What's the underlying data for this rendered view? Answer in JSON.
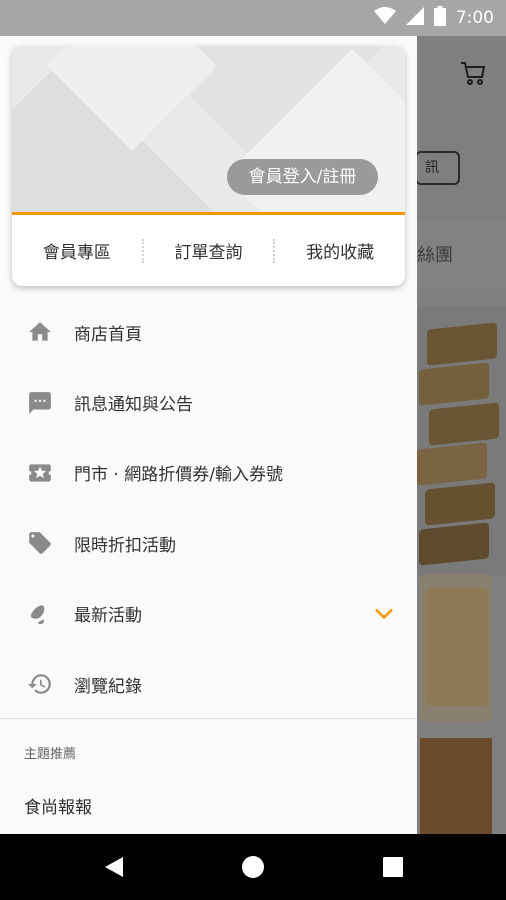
{
  "status_bar": {
    "time": "7:00",
    "icons": [
      "wifi-icon",
      "cellular-signal-icon",
      "battery-icon"
    ]
  },
  "background_app": {
    "partial_button_text": "訊",
    "partial_tab_text": "絲團"
  },
  "drawer": {
    "member_card": {
      "login_button": "會員登入/註冊",
      "links": [
        "會員專區",
        "訂單查詢",
        "我的收藏"
      ]
    },
    "menu": [
      {
        "icon": "home-icon",
        "label": "商店首頁"
      },
      {
        "icon": "message-icon",
        "label": "訊息通知與公告"
      },
      {
        "icon": "ticket-icon",
        "label": "門市 · 網路折價券/輸入券號"
      },
      {
        "icon": "tag-icon",
        "label": "限時折扣活動"
      },
      {
        "icon": "bell-icon",
        "label": "最新活動",
        "expandable": true
      },
      {
        "icon": "history-icon",
        "label": "瀏覽紀錄"
      }
    ],
    "section": {
      "title": "主題推薦",
      "items": [
        "食尚報報"
      ]
    }
  },
  "colors": {
    "accent": "#f39700",
    "scrim": "#7f7f7f",
    "status_bar": "#a6a6a6"
  },
  "nav_bar": {
    "buttons": [
      "back-icon",
      "home-circle-icon",
      "recents-icon"
    ]
  }
}
